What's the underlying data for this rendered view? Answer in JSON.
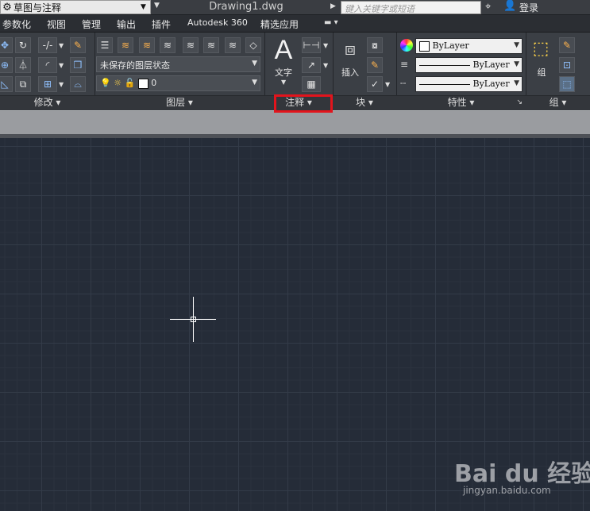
{
  "titlebar": {
    "workspace": "草图与注释",
    "document": "Drawing1.dwg",
    "search_placeholder": "键入关键字或短语",
    "login": "登录"
  },
  "menu_tabs": [
    "参数化",
    "视图",
    "管理",
    "输出",
    "插件",
    "Autodesk 360",
    "精选应用"
  ],
  "ribbon": {
    "modify": {
      "label": "修改"
    },
    "layers": {
      "label": "图层",
      "layer_state": "未保存的图层状态",
      "current_layer": "0"
    },
    "annotation": {
      "label": "注释",
      "text_label": "文字"
    },
    "block": {
      "label": "块",
      "insert_label": "插入"
    },
    "properties": {
      "label": "特性",
      "color": "ByLayer",
      "linetype": "ByLayer",
      "lineweight": "ByLayer"
    },
    "groups": {
      "label": "组",
      "group_label": "组"
    }
  },
  "watermark": {
    "logo": "Bai du 经验",
    "url": "jingyan.baidu.com"
  },
  "colors": {
    "highlight": "#e2141c",
    "canvas": "#252c38",
    "ribbon": "#3b3f45"
  }
}
